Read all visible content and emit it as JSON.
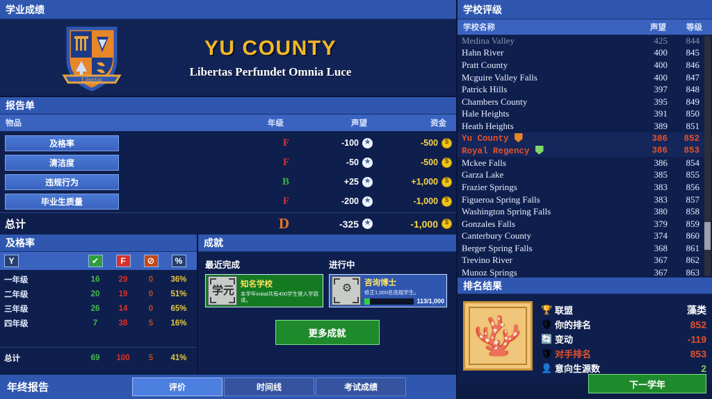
{
  "left": {
    "title": "学业成绩",
    "school": {
      "name": "YU COUNTY",
      "motto": "Libertas Perfundet Omnia Luce",
      "crest_banner": "Libertas"
    },
    "report": {
      "title": "报告单",
      "columns": {
        "item": "物品",
        "grade": "年级",
        "reputation": "声望",
        "funds": "资金"
      },
      "rows": [
        {
          "label": "及格率",
          "grade": "F",
          "grade_color": "#d8322c",
          "rep": "-100",
          "cash": "-500"
        },
        {
          "label": "清洁度",
          "grade": "F",
          "grade_color": "#d8322c",
          "rep": "-50",
          "cash": "-500"
        },
        {
          "label": "违规行为",
          "grade": "B",
          "grade_color": "#38b046",
          "rep": "+25",
          "cash": "+1,000"
        },
        {
          "label": "毕业生质量",
          "grade": "F",
          "grade_color": "#d8322c",
          "rep": "-200",
          "cash": "-1,000"
        }
      ],
      "total": {
        "label": "总计",
        "grade": "D",
        "grade_color": "#e8742a",
        "rep": "-325",
        "cash": "-1,000"
      }
    },
    "passrate": {
      "title": "及格率",
      "header_icons": {
        "year": "Y",
        "pass": "✔",
        "fail": "F",
        "banned": "⊘",
        "percent": "%"
      },
      "rows": [
        {
          "name": "一年级",
          "pass": "16",
          "fail": "29",
          "banned": "0",
          "pct": "36%"
        },
        {
          "name": "二年级",
          "pass": "20",
          "fail": "19",
          "banned": "0",
          "pct": "51%"
        },
        {
          "name": "三年级",
          "pass": "26",
          "fail": "14",
          "banned": "0",
          "pct": "65%"
        },
        {
          "name": "四年级",
          "pass": "7",
          "fail": "38",
          "banned": "5",
          "pct": "16%"
        }
      ],
      "total": {
        "name": "总计",
        "pass": "69",
        "fail": "100",
        "banned": "5",
        "pct": "41%"
      }
    },
    "achievements": {
      "title": "成就",
      "col_recent": "最近完成",
      "col_progress": "进行中",
      "recent": {
        "title": "知名学校",
        "desc": "本学年initial共有400学生登入学就读。",
        "icon": "diploma-icon"
      },
      "progress": {
        "title": "咨询博士",
        "desc": "修正1,000名违规学生。",
        "count": "113/1,000",
        "percent": 11.3,
        "icon": "counselor-icon"
      },
      "more_button": "更多成就"
    },
    "bottom": {
      "title": "年终报告",
      "tabs": [
        {
          "label": "评价",
          "active": true
        },
        {
          "label": "时间线",
          "active": false
        },
        {
          "label": "考试成绩",
          "active": false
        }
      ]
    }
  },
  "right": {
    "ratings": {
      "title": "学校评级",
      "columns": {
        "name": "学校名称",
        "reputation": "声望",
        "rank": "等级"
      },
      "rows": [
        {
          "name": "Medina Valley",
          "rep": "425",
          "rank": "844",
          "clipped": true,
          "highlight": false,
          "shield": ""
        },
        {
          "name": "Hahn River",
          "rep": "400",
          "rank": "845",
          "clipped": false,
          "highlight": false,
          "shield": ""
        },
        {
          "name": "Pratt County",
          "rep": "400",
          "rank": "846",
          "clipped": false,
          "highlight": false,
          "shield": ""
        },
        {
          "name": "Mcguire Valley Falls",
          "rep": "400",
          "rank": "847",
          "clipped": false,
          "highlight": false,
          "shield": ""
        },
        {
          "name": "Patrick Hills",
          "rep": "397",
          "rank": "848",
          "clipped": false,
          "highlight": false,
          "shield": ""
        },
        {
          "name": "Chambers County",
          "rep": "395",
          "rank": "849",
          "clipped": false,
          "highlight": false,
          "shield": ""
        },
        {
          "name": "Hale Heights",
          "rep": "391",
          "rank": "850",
          "clipped": false,
          "highlight": false,
          "shield": ""
        },
        {
          "name": "Heath Heights",
          "rep": "389",
          "rank": "851",
          "clipped": false,
          "highlight": false,
          "shield": ""
        },
        {
          "name": "Yu County",
          "rep": "386",
          "rank": "852",
          "clipped": false,
          "highlight": true,
          "shield": "orange"
        },
        {
          "name": "Royal Regency",
          "rep": "386",
          "rank": "853",
          "clipped": false,
          "highlight": true,
          "shield": "green"
        },
        {
          "name": "Mckee Falls",
          "rep": "386",
          "rank": "854",
          "clipped": false,
          "highlight": false,
          "shield": ""
        },
        {
          "name": "Garza Lake",
          "rep": "385",
          "rank": "855",
          "clipped": false,
          "highlight": false,
          "shield": ""
        },
        {
          "name": "Frazier Springs",
          "rep": "383",
          "rank": "856",
          "clipped": false,
          "highlight": false,
          "shield": ""
        },
        {
          "name": "Figueroa Spring Falls",
          "rep": "383",
          "rank": "857",
          "clipped": false,
          "highlight": false,
          "shield": ""
        },
        {
          "name": "Washington Spring Falls",
          "rep": "380",
          "rank": "858",
          "clipped": false,
          "highlight": false,
          "shield": ""
        },
        {
          "name": "Gonzales Falls",
          "rep": "379",
          "rank": "859",
          "clipped": false,
          "highlight": false,
          "shield": ""
        },
        {
          "name": "Canterbury County",
          "rep": "374",
          "rank": "860",
          "clipped": false,
          "highlight": false,
          "shield": ""
        },
        {
          "name": "Berger Spring Falls",
          "rep": "368",
          "rank": "861",
          "clipped": false,
          "highlight": false,
          "shield": ""
        },
        {
          "name": "Trevino River",
          "rep": "367",
          "rank": "862",
          "clipped": false,
          "highlight": false,
          "shield": ""
        },
        {
          "name": "Munoz Springs",
          "rep": "367",
          "rank": "863",
          "clipped": false,
          "highlight": false,
          "shield": ""
        }
      ]
    },
    "results": {
      "title": "排名结果",
      "badge_icon": "coral-badge",
      "rows": [
        {
          "icon": "🏆",
          "label": "联盟",
          "value": "藻类",
          "value_color": "#ffffff",
          "label_red": false
        },
        {
          "icon": "🛡",
          "label": "你的排名",
          "value": "852",
          "value_color": "#e2522d",
          "label_red": false
        },
        {
          "icon": "🔄",
          "label": "变动",
          "value": "-119",
          "value_color": "#e2522d",
          "label_red": false
        },
        {
          "icon": "🛡",
          "label": "对手排名",
          "value": "853",
          "value_color": "#e2522d",
          "label_red": true
        },
        {
          "icon": "👤",
          "label": "意向生源数",
          "value": "2",
          "value_color": "#7fd84a",
          "label_red": false
        }
      ],
      "next_button": "下一学年"
    }
  }
}
